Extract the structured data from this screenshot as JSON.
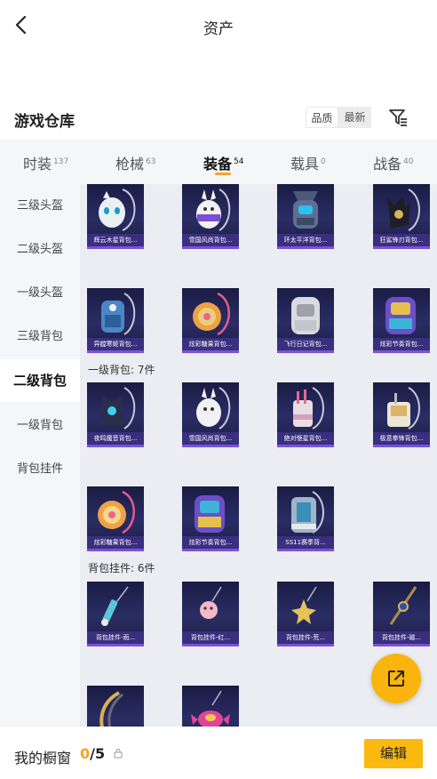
{
  "header": {
    "title": "资产"
  },
  "warehouse": {
    "title": "游戏仓库",
    "sort_options": [
      "品质",
      "最新"
    ]
  },
  "tabs": [
    {
      "label": "时装",
      "count": "137"
    },
    {
      "label": "枪械",
      "count": "63"
    },
    {
      "label": "装备",
      "count": "54"
    },
    {
      "label": "载具",
      "count": "0"
    },
    {
      "label": "战备",
      "count": "40"
    }
  ],
  "active_tab": "装备",
  "sidebar": {
    "items": [
      "三级头盔",
      "二级头盔",
      "一级头盔",
      "三级背包",
      "二级背包",
      "一级背包",
      "背包挂件"
    ],
    "active": "二级背包"
  },
  "sections": [
    {
      "label": "",
      "items": [
        "辉云木星背包...",
        "雪国风尚背包...",
        "环太平洋背包...",
        "狂鲨锋刃背包...",
        "异膛寒姬背包...",
        "炫彩糖果背包...",
        "飞行日记背包...",
        "炫彩节奏背包..."
      ]
    },
    {
      "label": "一级背包: 7件",
      "items": [
        "夜鸣魔音背包...",
        "雪国风尚背包...",
        "绝对惬星背包...",
        "极意拳锋背包...",
        "炫彩糖果背包...",
        "炫彩节奏背包...",
        "SS11赛季背..."
      ]
    },
    {
      "label": "背包挂件: 6件",
      "items": [
        "背包挂件-雨...",
        "背包挂件-红...",
        "背包挂件-荒...",
        "背包挂件-磁...",
        "",
        ""
      ]
    }
  ],
  "bottom": {
    "label": "我的橱窗",
    "current": "0",
    "total": "/5",
    "edit_label": "编辑"
  },
  "colors": {
    "accent": "#f9b90f",
    "card_bg": "#22255a",
    "card_border": "#7a52d6"
  },
  "icons": [
    "back-arrow-icon",
    "filter-icon",
    "lock-icon",
    "share-icon"
  ]
}
